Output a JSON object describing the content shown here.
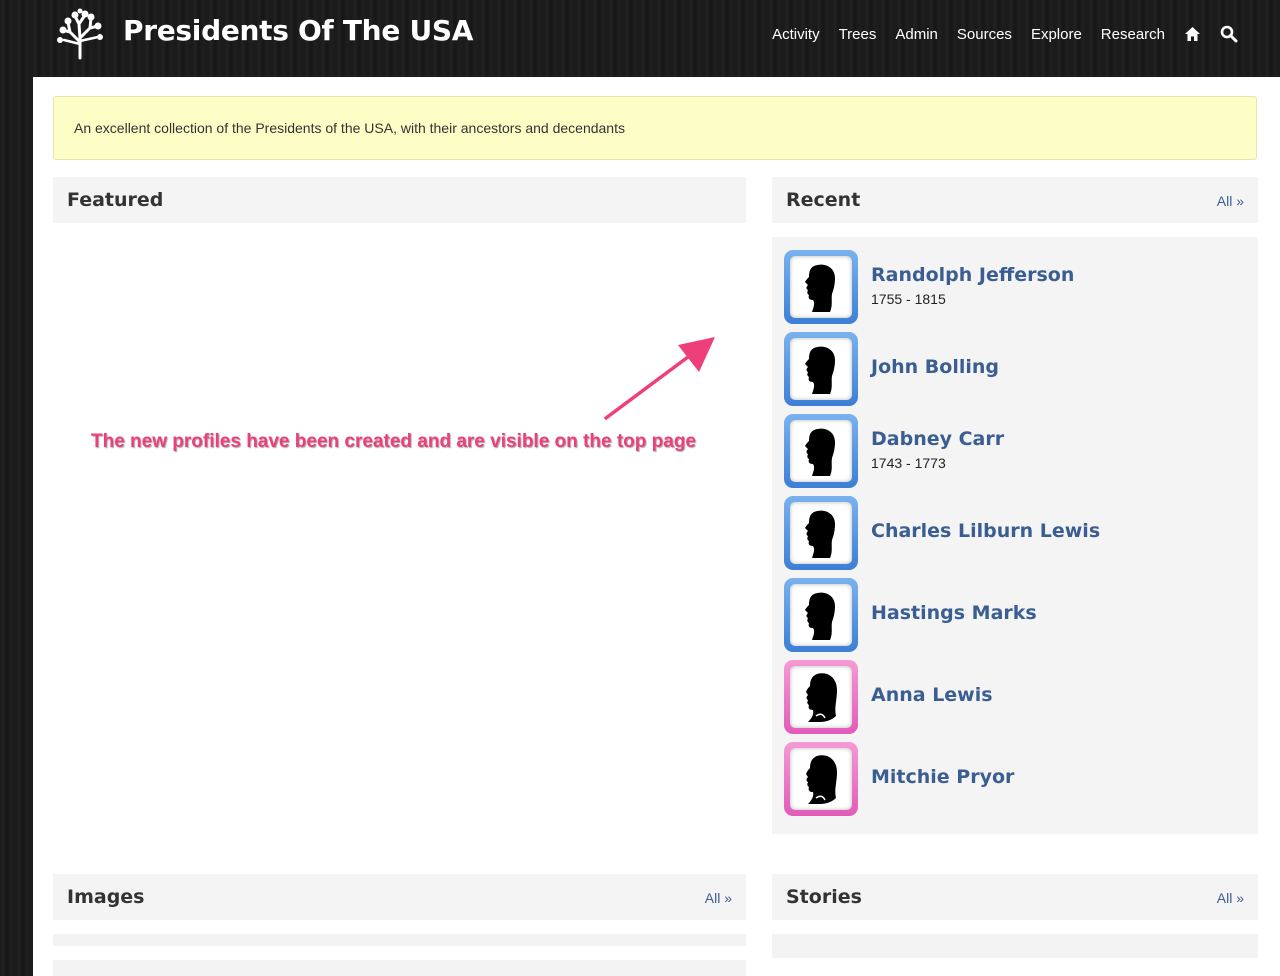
{
  "header": {
    "site_title": "Presidents Of The USA",
    "logo_icon": "tree-icon",
    "nav": [
      "Activity",
      "Trees",
      "Admin",
      "Sources",
      "Explore",
      "Research"
    ],
    "nav_icons": [
      "home-icon",
      "search-icon"
    ]
  },
  "notice": {
    "text": "An excellent collection of the Presidents of the USA, with their ancestors and decendants"
  },
  "sections": {
    "featured": {
      "title": "Featured"
    },
    "recent": {
      "title": "Recent",
      "all_label": "All »"
    },
    "images": {
      "title": "Images",
      "all_label": "All »"
    },
    "stories": {
      "title": "Stories",
      "all_label": "All »"
    }
  },
  "recent_people": [
    {
      "name": "Randolph Jefferson",
      "dates": "1755 - 1815",
      "gender": "male"
    },
    {
      "name": "John Bolling",
      "dates": "",
      "gender": "male"
    },
    {
      "name": "Dabney Carr",
      "dates": "1743 - 1773",
      "gender": "male"
    },
    {
      "name": "Charles Lilburn Lewis",
      "dates": "",
      "gender": "male"
    },
    {
      "name": "Hastings Marks",
      "dates": "",
      "gender": "male"
    },
    {
      "name": "Anna Lewis",
      "dates": "",
      "gender": "female"
    },
    {
      "name": "Mitchie Pryor",
      "dates": "",
      "gender": "female"
    }
  ],
  "annotation": {
    "text": "The new profiles have been created and are visible on the top page"
  },
  "colors": {
    "link": "#3b5e92",
    "male_frame": "#3c7fd6",
    "female_frame": "#e25bb8",
    "annotation": "#ef3f7a",
    "notice_bg": "#fdfdc6"
  }
}
